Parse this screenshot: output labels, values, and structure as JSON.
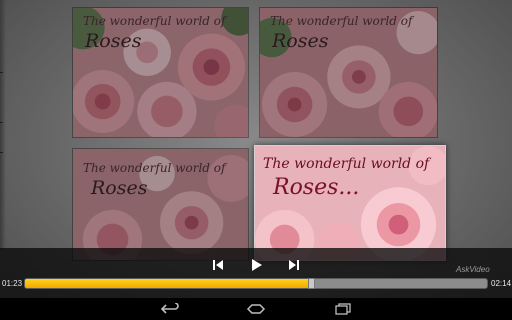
{
  "thumbnails": [
    {
      "line1": "The wonderful world of",
      "line2": "Roses"
    },
    {
      "line1": "The wonderful world of",
      "line2": "Roses"
    },
    {
      "line1": "The wonderful world of",
      "line2": "Roses"
    },
    {
      "line1": "The wonderful world of",
      "line2": "Roses..."
    }
  ],
  "player": {
    "elapsed": "01:23",
    "total": "02:14",
    "progress": 0.619,
    "watermark": "AskVideo",
    "accent_color": "#f7b500"
  },
  "icons": {
    "previous": "skip-previous-icon",
    "play": "play-icon",
    "next": "skip-next-icon",
    "back": "back-icon",
    "home": "home-icon",
    "recents": "recent-apps-icon"
  }
}
